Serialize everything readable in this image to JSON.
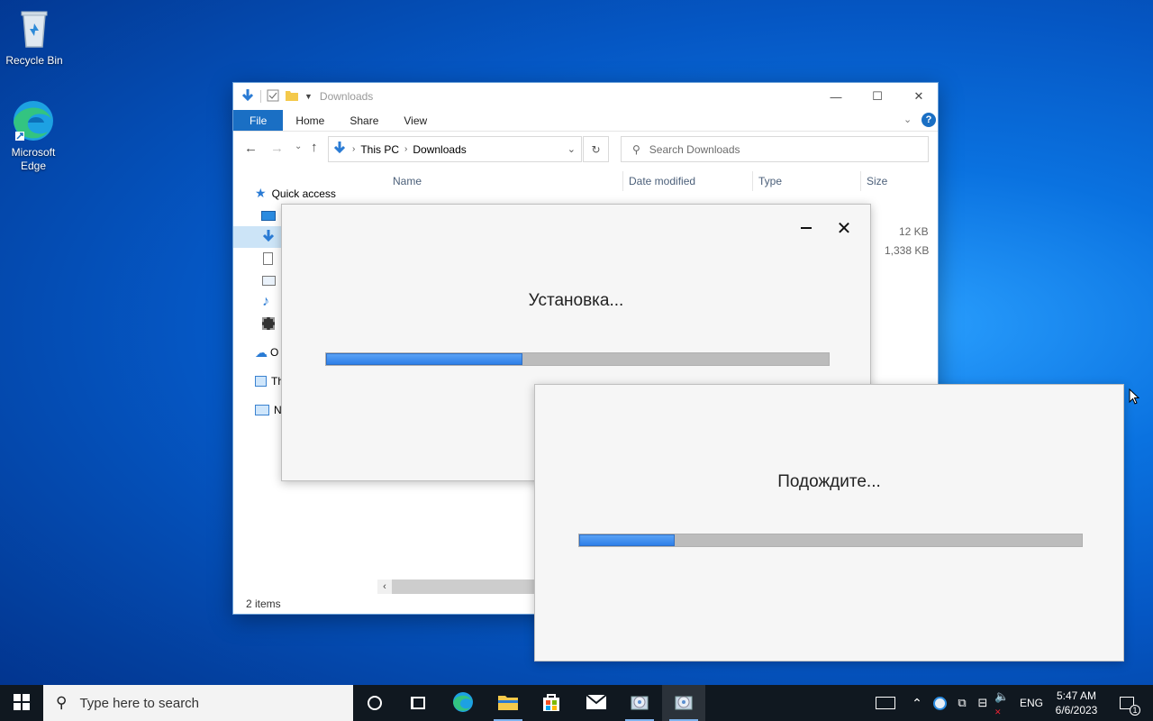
{
  "desktop": {
    "icons": [
      {
        "label": "Recycle Bin"
      },
      {
        "label": "Microsoft Edge"
      }
    ]
  },
  "explorer": {
    "title": "Downloads",
    "ribbon_tabs": [
      "File",
      "Home",
      "Share",
      "View"
    ],
    "breadcrumb": [
      "This PC",
      "Downloads"
    ],
    "search_placeholder": "Search Downloads",
    "columns": [
      "Name",
      "Date modified",
      "Type",
      "Size"
    ],
    "sidebar": {
      "quick_access": "Quick access",
      "onedrive_partial": "O",
      "thispc_partial": "Th",
      "network_partial": "N"
    },
    "file_sizes": [
      "12 KB",
      "1,338 KB"
    ],
    "status": "2 items"
  },
  "install_dialog": {
    "message": "Установка...",
    "progress": 0.39
  },
  "wait_dialog": {
    "message": "Подождите...",
    "progress": 0.19
  },
  "taskbar": {
    "search_placeholder": "Type here to search",
    "language": "ENG",
    "time": "5:47 AM",
    "date": "6/6/2023",
    "notification_count": "1"
  },
  "colors": {
    "accent": "#1a6fc4",
    "progress_fill": "#3b8ef0",
    "progress_track": "#bcbcbc",
    "taskbar": "#101820"
  }
}
